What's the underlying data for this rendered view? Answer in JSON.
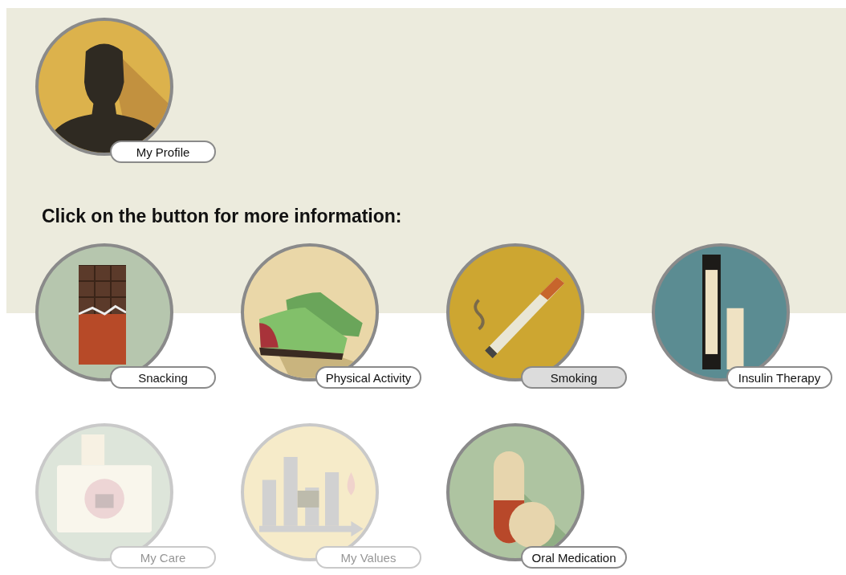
{
  "profile": {
    "label": "My Profile",
    "kind": "person",
    "selected": false,
    "disabled": false
  },
  "heading": "Click on the button for more information:",
  "topics": [
    {
      "label": "Snacking",
      "kind": "chocolate",
      "selected": false,
      "disabled": false
    },
    {
      "label": "Physical Activity",
      "kind": "shoes",
      "selected": false,
      "disabled": false
    },
    {
      "label": "Smoking",
      "kind": "cigarette",
      "selected": true,
      "disabled": false
    },
    {
      "label": "Insulin Therapy",
      "kind": "insulin",
      "selected": false,
      "disabled": false
    },
    {
      "label": "My Care",
      "kind": "briefcase",
      "selected": false,
      "disabled": true
    },
    {
      "label": "My Values",
      "kind": "chart",
      "selected": false,
      "disabled": true
    },
    {
      "label": "Oral Medication",
      "kind": "pills",
      "selected": false,
      "disabled": false
    }
  ]
}
